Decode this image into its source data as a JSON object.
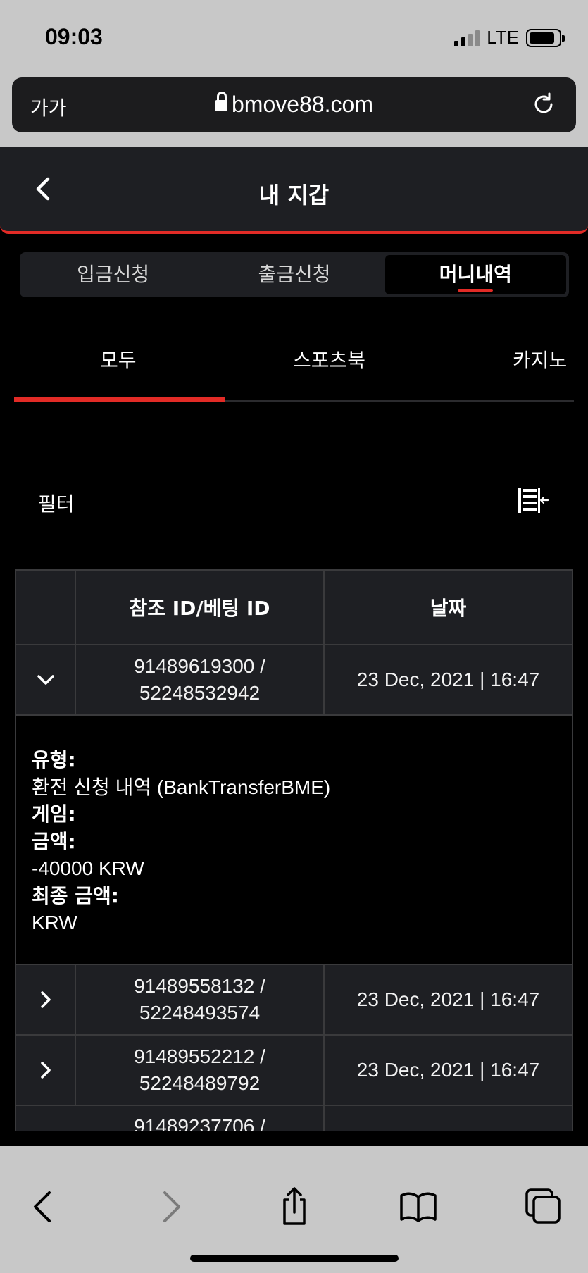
{
  "status": {
    "time": "09:03",
    "network": "LTE"
  },
  "browser": {
    "aa_label": "가가",
    "url": "bmove88.com"
  },
  "header": {
    "title": "내 지갑"
  },
  "segments": [
    {
      "label": "입금신청"
    },
    {
      "label": "출금신청"
    },
    {
      "label": "머니내역"
    }
  ],
  "categories": [
    {
      "label": "모두"
    },
    {
      "label": "스포츠북"
    },
    {
      "label": "카지노"
    }
  ],
  "filter": {
    "label": "필터"
  },
  "table": {
    "headers": {
      "ref": "참조 ID/베팅 ID",
      "date": "날짜"
    },
    "rows": [
      {
        "ref_line1": "91489619300 /",
        "ref_line2": "52248532942",
        "date": "23 Dec, 2021 | 16:47",
        "expanded": true
      },
      {
        "ref_line1": "91489558132 /",
        "ref_line2": "52248493574",
        "date": "23 Dec, 2021 | 16:47",
        "expanded": false
      },
      {
        "ref_line1": "91489552212 /",
        "ref_line2": "52248489792",
        "date": "23 Dec, 2021 | 16:47",
        "expanded": false
      },
      {
        "ref_line1": "91489237706 /",
        "ref_line2": "",
        "date": "",
        "expanded": false
      }
    ],
    "detail": {
      "type_label": "유형:",
      "type_value": "환전 신청 내역 (BankTransferBME)",
      "game_label": "게임:",
      "amount_label": "금액:",
      "amount_value": "-40000 KRW",
      "final_label": "최종 금액:",
      "final_value": "KRW"
    }
  },
  "icons": {
    "back": "chevron-left-icon",
    "reload": "reload-icon",
    "lock": "lock-icon",
    "filter": "filter-list-icon",
    "expand": "chevron-down-icon",
    "collapse": "chevron-right-icon",
    "share": "share-icon",
    "bookmarks": "book-icon",
    "tabs": "tabs-icon"
  },
  "colors": {
    "accent": "#e22b26",
    "panel": "#1e1f23",
    "background": "#000000",
    "chrome": "#c8c8c8"
  }
}
